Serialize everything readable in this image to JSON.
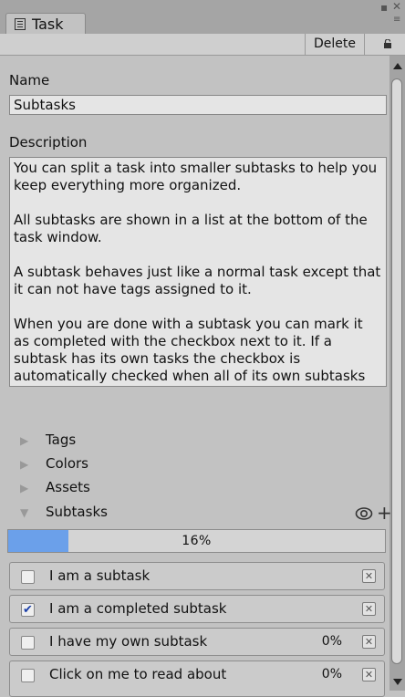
{
  "window": {
    "tab_label": "Task",
    "toolbar": {
      "delete_label": "Delete"
    }
  },
  "fields": {
    "name_label": "Name",
    "name_value": "Subtasks",
    "description_label": "Description",
    "description_paragraphs": [
      "You can split a task into smaller subtasks to help you keep everything more organized.",
      "All subtasks are shown in a list at the bottom of the task window.",
      "A subtask behaves just like a normal task except that it can not have tags assigned to it.",
      "When you are done with a subtask you can mark it as completed with the checkbox next to it. If a subtask has its own tasks the checkbox is automatically checked when all of its own subtasks are completed. You can hide completed tasks by clicking on the eye."
    ]
  },
  "foldouts": [
    {
      "label": "Tags",
      "expanded": false
    },
    {
      "label": "Colors",
      "expanded": false
    },
    {
      "label": "Assets",
      "expanded": false
    },
    {
      "label": "Subtasks",
      "expanded": true
    }
  ],
  "subtasks": {
    "progress_percent": 16,
    "progress_text": "16%",
    "items": [
      {
        "label": "I am a subtask",
        "checked": false,
        "percent": ""
      },
      {
        "label": "I am a completed subtask",
        "checked": true,
        "percent": ""
      },
      {
        "label": "I have my own subtask",
        "checked": false,
        "percent": "0%"
      },
      {
        "label": "Click on me to read about",
        "checked": false,
        "percent": "0%"
      }
    ]
  },
  "colors": {
    "progress_fill": "#6ba0ea",
    "checkmark": "#1b3fa8"
  }
}
